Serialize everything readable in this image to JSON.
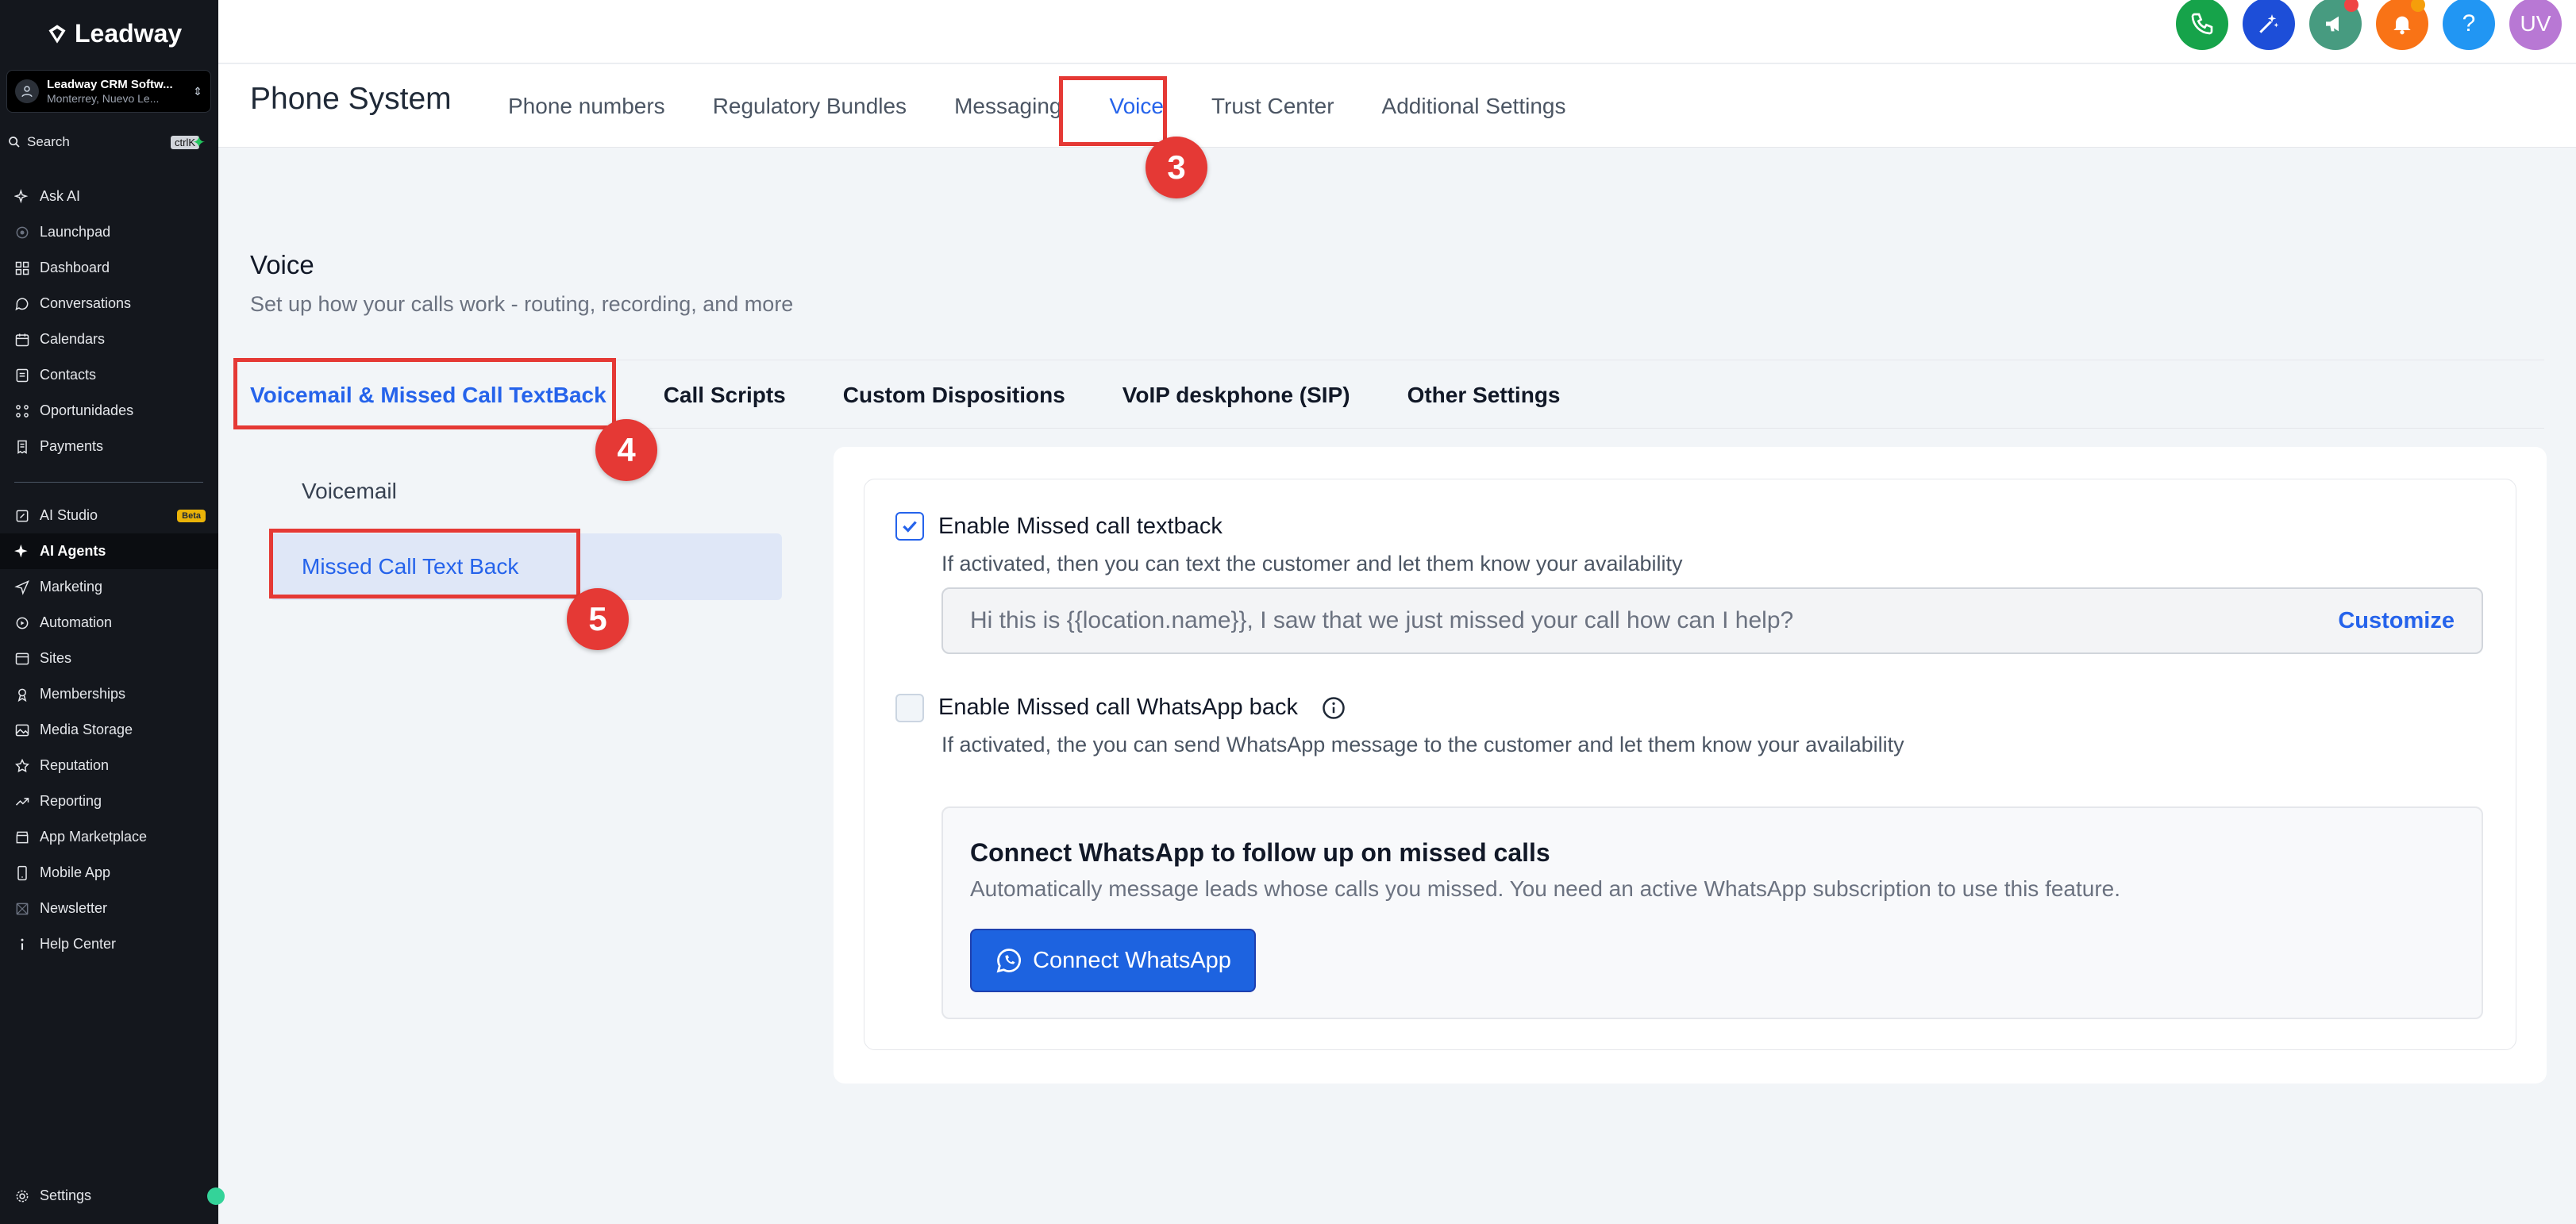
{
  "brand": {
    "name": "Leadway"
  },
  "account": {
    "name": "Leadway CRM Softw...",
    "location": "Monterrey, Nuevo Le..."
  },
  "search": {
    "label": "Search",
    "shortcut": "ctrlK"
  },
  "sidebar": {
    "items": [
      {
        "label": "Ask AI",
        "icon": "sparkles-icon"
      },
      {
        "label": "Launchpad",
        "icon": "rocket-icon"
      },
      {
        "label": "Dashboard",
        "icon": "grid-icon"
      },
      {
        "label": "Conversations",
        "icon": "chat-icon"
      },
      {
        "label": "Calendars",
        "icon": "calendar-icon"
      },
      {
        "label": "Contacts",
        "icon": "contacts-icon"
      },
      {
        "label": "Oportunidades",
        "icon": "funnel-icon"
      },
      {
        "label": "Payments",
        "icon": "receipt-icon"
      }
    ],
    "items2": [
      {
        "label": "AI Studio",
        "icon": "ai-studio-icon",
        "badge": "Beta"
      },
      {
        "label": "AI Agents",
        "icon": "sparkles-icon",
        "active": true
      },
      {
        "label": "Marketing",
        "icon": "send-icon"
      },
      {
        "label": "Automation",
        "icon": "automation-icon"
      },
      {
        "label": "Sites",
        "icon": "sites-icon"
      },
      {
        "label": "Memberships",
        "icon": "membership-icon"
      },
      {
        "label": "Media Storage",
        "icon": "image-icon"
      },
      {
        "label": "Reputation",
        "icon": "star-icon"
      },
      {
        "label": "Reporting",
        "icon": "chart-icon"
      },
      {
        "label": "App Marketplace",
        "icon": "store-icon"
      },
      {
        "label": "Mobile App",
        "icon": "phone-icon"
      },
      {
        "label": "Newsletter",
        "icon": "newsletter-icon"
      },
      {
        "label": "Help Center",
        "icon": "info-icon"
      }
    ],
    "settings": "Settings"
  },
  "topbar": {
    "avatar": "UV",
    "help": "?"
  },
  "phone_system": {
    "title": "Phone System",
    "tabs": [
      "Phone numbers",
      "Regulatory Bundles",
      "Messaging",
      "Voice",
      "Trust Center",
      "Additional Settings"
    ],
    "active_tab": "Voice"
  },
  "voice": {
    "title": "Voice",
    "subtitle": "Set up how your calls work - routing, recording, and more",
    "tabs": [
      "Voicemail & Missed Call TextBack",
      "Call Scripts",
      "Custom Dispositions",
      "VoIP deskphone (SIP)",
      "Other Settings"
    ],
    "subnav": [
      "Voicemail",
      "Missed Call Text Back"
    ]
  },
  "missed_call": {
    "textback_label": "Enable Missed call textback",
    "textback_checked": true,
    "textback_desc": "If activated, then you can text the customer and let them know your availability",
    "message": "Hi this is {{location.name}}, I saw that we just missed your call how can I help?",
    "customize": "Customize",
    "whatsapp_label": "Enable Missed call WhatsApp back",
    "whatsapp_checked": false,
    "whatsapp_desc": "If activated, the you can send WhatsApp message to the customer and let them know your availability",
    "connect_title": "Connect WhatsApp to follow up on missed calls",
    "connect_desc": "Automatically message leads whose calls you missed. You need an active WhatsApp subscription to use this feature.",
    "connect_button": "Connect WhatsApp"
  },
  "annotations": [
    "3",
    "4",
    "5"
  ],
  "colors": {
    "accent": "#2563eb",
    "annotation": "#e53935",
    "sidebar": "#14171d"
  }
}
